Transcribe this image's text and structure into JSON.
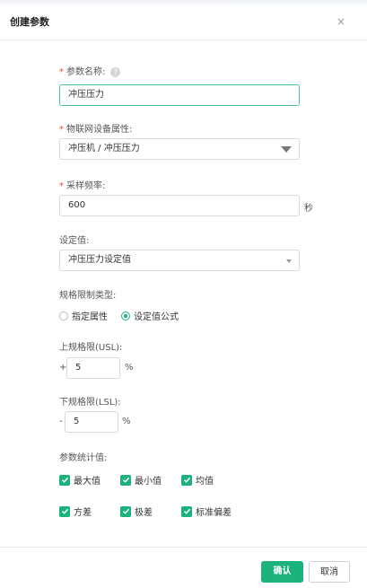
{
  "dialog": {
    "title": "创建参数",
    "close_glyph": "×"
  },
  "form": {
    "param_name": {
      "required_mark": "*",
      "label": "参数名称:",
      "help_glyph": "?",
      "value": "冲压压力"
    },
    "iot_attr": {
      "required_mark": "*",
      "label": "物联网设备属性:",
      "value": "冲压机 / 冲压压力"
    },
    "sample_freq": {
      "required_mark": "*",
      "label": "采样频率:",
      "value": "600",
      "unit": "秒"
    },
    "set_value": {
      "label": "设定值:",
      "value": "冲压压力设定值"
    },
    "limit_type": {
      "label": "规格限制类型:",
      "options": [
        "指定属性",
        "设定值公式"
      ],
      "selected": "设定值公式"
    },
    "usl": {
      "label": "上规格限(USL):",
      "sign": "+",
      "value": "5",
      "unit": "%"
    },
    "lsl": {
      "label": "下规格限(LSL):",
      "sign": "-",
      "value": "5",
      "unit": "%"
    },
    "stats": {
      "label": "参数统计值:",
      "items": [
        "最大值",
        "最小值",
        "均值",
        "方差",
        "极差",
        "标准偏差"
      ],
      "checked": [
        true,
        true,
        true,
        true,
        true,
        true
      ]
    }
  },
  "footer": {
    "confirm": "确认",
    "cancel": "取消"
  },
  "colors": {
    "accent": "#1bb27b",
    "focus_border": "#4ec2a3",
    "required": "#e74c3c"
  }
}
